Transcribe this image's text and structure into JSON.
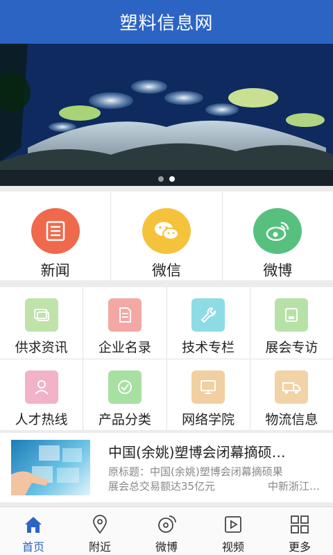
{
  "header": {
    "title": "塑料信息网"
  },
  "social": [
    {
      "label": "新闻",
      "color": "#ef6a4c"
    },
    {
      "label": "微信",
      "color": "#f5c33b"
    },
    {
      "label": "微博",
      "color": "#57c07f"
    }
  ],
  "grid": [
    {
      "label": "供求资讯",
      "color": "#bfe3a8"
    },
    {
      "label": "企业名录",
      "color": "#f3a8a4"
    },
    {
      "label": "技术专栏",
      "color": "#8ddce5"
    },
    {
      "label": "展会专访",
      "color": "#b6e2a8"
    },
    {
      "label": "人才热线",
      "color": "#f2b2c8"
    },
    {
      "label": "产品分类",
      "color": "#a8e0a2"
    },
    {
      "label": "网络学院",
      "color": "#f2cfa0"
    },
    {
      "label": "物流信息",
      "color": "#f2d3a6"
    }
  ],
  "news": {
    "title": "中国(余姚)塑博会闭幕摘硕…",
    "summary_line1": "原标题：中国(余姚)塑博会闭幕摘硕果",
    "summary_line2": "展会总交易额达35亿元",
    "source": "中新浙江…"
  },
  "tabs": [
    {
      "label": "首页",
      "icon": "home-icon",
      "active": true
    },
    {
      "label": "附近",
      "icon": "location-icon"
    },
    {
      "label": "微博",
      "icon": "weibo-icon"
    },
    {
      "label": "视频",
      "icon": "video-icon"
    },
    {
      "label": "更多",
      "icon": "more-grid-icon"
    }
  ],
  "colors": {
    "brand": "#2c64c4",
    "active_tab": "#2c64c4"
  }
}
